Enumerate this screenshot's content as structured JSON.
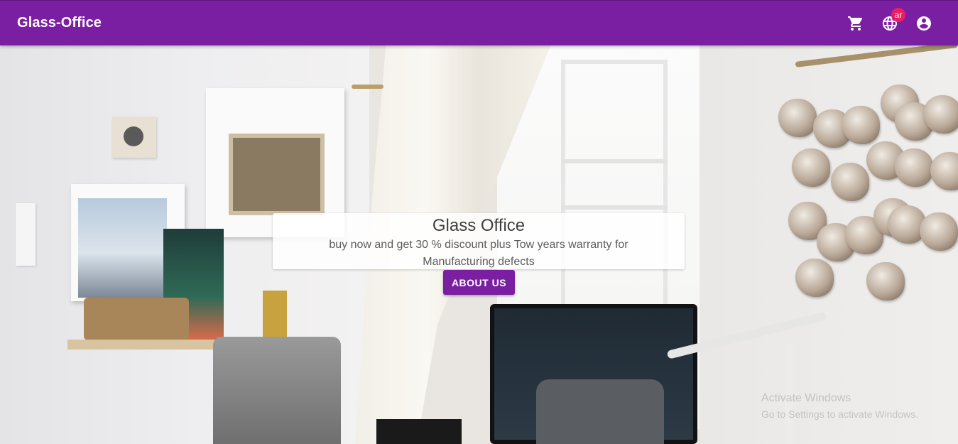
{
  "appbar": {
    "brand": "Glass-Office",
    "icons": {
      "cart": "shopping-cart-icon",
      "language": "globe-icon",
      "account": "account-circle-icon"
    },
    "language_badge": "ar",
    "bar_color": "#7b1fa2",
    "badge_color": "#e91e63"
  },
  "hero": {
    "title": "Glass Office",
    "subtitle": "buy now and get 30 % discount plus Tow years warranty for Manufacturing defects",
    "button_label": "ABOUT US"
  },
  "watermark": {
    "line1": "Activate Windows",
    "line2": "Go to Settings to activate Windows."
  }
}
